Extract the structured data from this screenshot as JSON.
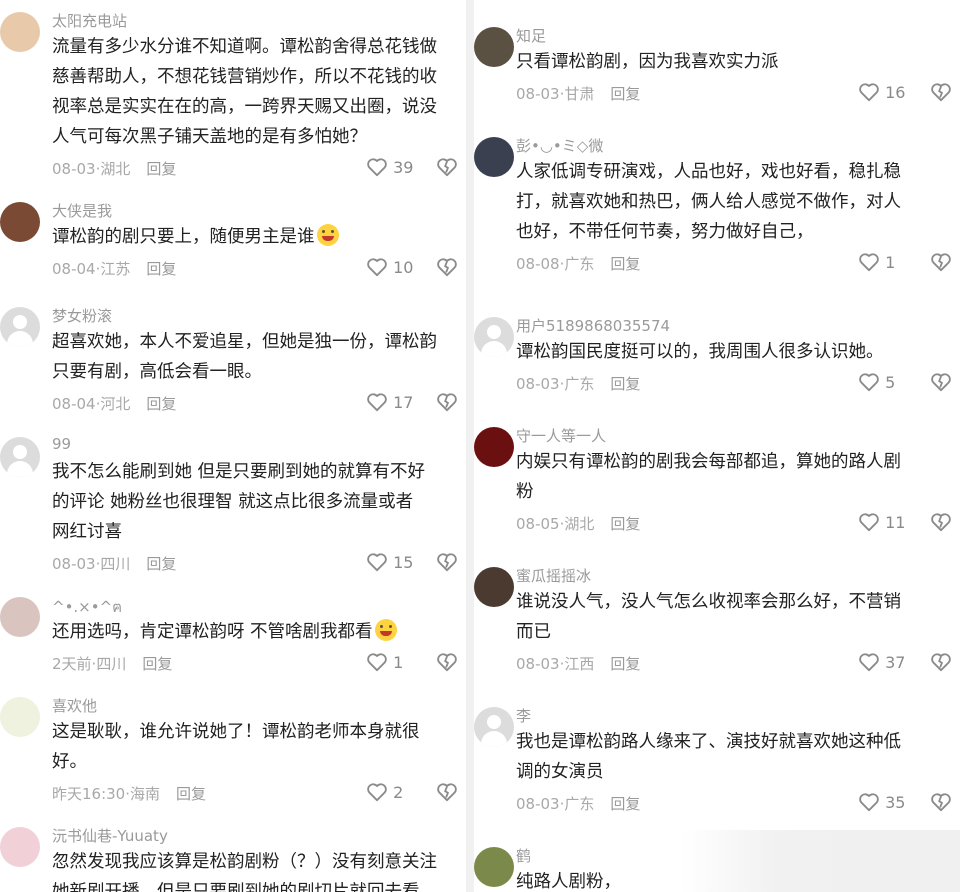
{
  "left": {
    "comments": [
      {
        "user": "太阳充电站",
        "lines": [
          "流量有多少水分谁不知道啊。谭松韵舍得总花钱做",
          "慈善帮助人，不想花钱营销炒作，所以不花钱的收",
          "视率总是实实在在的高，一跨界天赐又出圈，说没",
          "人气可每次黑子铺天盖地的是有多怕她？"
        ],
        "time": "08-03",
        "location": "湖北",
        "reply": "回复",
        "likes": "39"
      },
      {
        "user": "大侠是我",
        "lines": [
          "谭松韵的剧只要上，随便男主是谁"
        ],
        "time": "08-04",
        "location": "江苏",
        "reply": "回复",
        "likes": "10"
      },
      {
        "user": "梦女粉滚",
        "lines": [
          "超喜欢她，本人不爱追星，但她是独一份，谭松韵",
          "只要有剧，高低会看一眼。"
        ],
        "time": "08-04",
        "location": "河北",
        "reply": "回复",
        "likes": "17"
      },
      {
        "user": "99",
        "lines": [
          "我不怎么能刷到她 但是只要刷到她的就算有不好",
          "的评论 她粉丝也很理智 就这点比很多流量或者",
          "网红讨喜"
        ],
        "time": "08-03",
        "location": "四川",
        "reply": "回复",
        "likes": "15"
      },
      {
        "user": "^•.×•^ฅ",
        "lines": [
          "还用选吗，肯定谭松韵呀 不管啥剧我都看"
        ],
        "time": "2天前",
        "location": "四川",
        "reply": "回复",
        "likes": "1"
      },
      {
        "user": "喜欢他",
        "lines": [
          "这是耿耿，谁允许说她了！谭松韵老师本身就很",
          "好。"
        ],
        "time": "昨天16:30",
        "location": "海南",
        "reply": "回复",
        "likes": "2"
      },
      {
        "user": "沅书仙巷-Yuuaty",
        "lines": [
          "忽然发现我应该算是松韵剧粉（？）没有刻意关注",
          "她新剧开播，但是只要刷到她的剧切片就回去看"
        ],
        "time": "",
        "location": "",
        "reply": "",
        "likes": ""
      }
    ]
  },
  "right": {
    "comments": [
      {
        "user": "知足",
        "lines": [
          "只看谭松韵剧，因为我喜欢实力派"
        ],
        "time": "08-03",
        "location": "甘肃",
        "reply": "回复",
        "likes": "16"
      },
      {
        "user": "彭•◡•ミ◇微",
        "lines": [
          "人家低调专研演戏，人品也好，戏也好看，稳扎稳",
          "打，就喜欢她和热巴，俩人给人感觉不做作，对人",
          "也好，不带任何节奏，努力做好自己，"
        ],
        "time": "08-08",
        "location": "广东",
        "reply": "回复",
        "likes": "1"
      },
      {
        "user": "用户5189868035574",
        "lines": [
          "谭松韵国民度挺可以的，我周围人很多认识她。"
        ],
        "time": "08-03",
        "location": "广东",
        "reply": "回复",
        "likes": "5"
      },
      {
        "user": "守一人等一人",
        "lines": [
          "内娱只有谭松韵的剧我会每部都追，算她的路人剧",
          "粉"
        ],
        "time": "08-05",
        "location": "湖北",
        "reply": "回复",
        "likes": "11"
      },
      {
        "user": "蜜瓜摇摇冰",
        "lines": [
          "谁说没人气，没人气怎么收视率会那么好，不营销",
          "而已"
        ],
        "time": "08-03",
        "location": "江西",
        "reply": "回复",
        "likes": "37"
      },
      {
        "user": "李",
        "lines": [
          "我也是谭松韵路人缘来了、演技好就喜欢她这种低",
          "调的女演员"
        ],
        "time": "08-03",
        "location": "广东",
        "reply": "回复",
        "likes": "35"
      },
      {
        "user": "鹤",
        "lines": [
          "纯路人剧粉，"
        ],
        "time": "",
        "location": "",
        "reply": "",
        "likes": ""
      }
    ]
  },
  "colors": {
    "text": "#222222",
    "meta": "#a8a8a8",
    "icon": "#8a8a8a"
  },
  "icons": {
    "like": "heart-outline-icon",
    "dislike": "broken-heart-icon"
  }
}
